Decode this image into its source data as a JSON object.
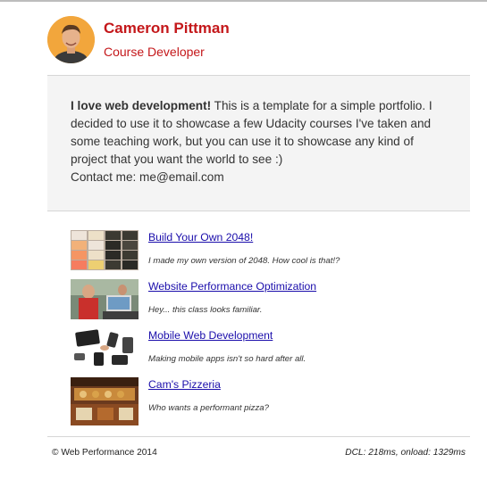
{
  "profile": {
    "name": "Cameron Pittman",
    "title": "Course Developer"
  },
  "intro": {
    "bold": "I love web development!",
    "text": " This is a template for a simple portfolio. I decided to use it to showcase a few Udacity courses I've taken and some teaching work, but you can use it to showcase any kind of project that you want the world to see :)",
    "contact": "Contact me: me@email.com"
  },
  "projects": [
    {
      "title": "Build Your Own 2048!",
      "description": "I made my own version of 2048. How cool is that!?"
    },
    {
      "title": "Website Performance Optimization",
      "description": "Hey... this class looks familiar."
    },
    {
      "title": "Mobile Web Development",
      "description": "Making mobile apps isn't so hard after all."
    },
    {
      "title": "Cam's Pizzeria",
      "description": "Who wants a performant pizza?"
    }
  ],
  "footer": {
    "copyright": "© Web Performance 2014",
    "perf": "DCL: 218ms, onload: 1329ms"
  }
}
